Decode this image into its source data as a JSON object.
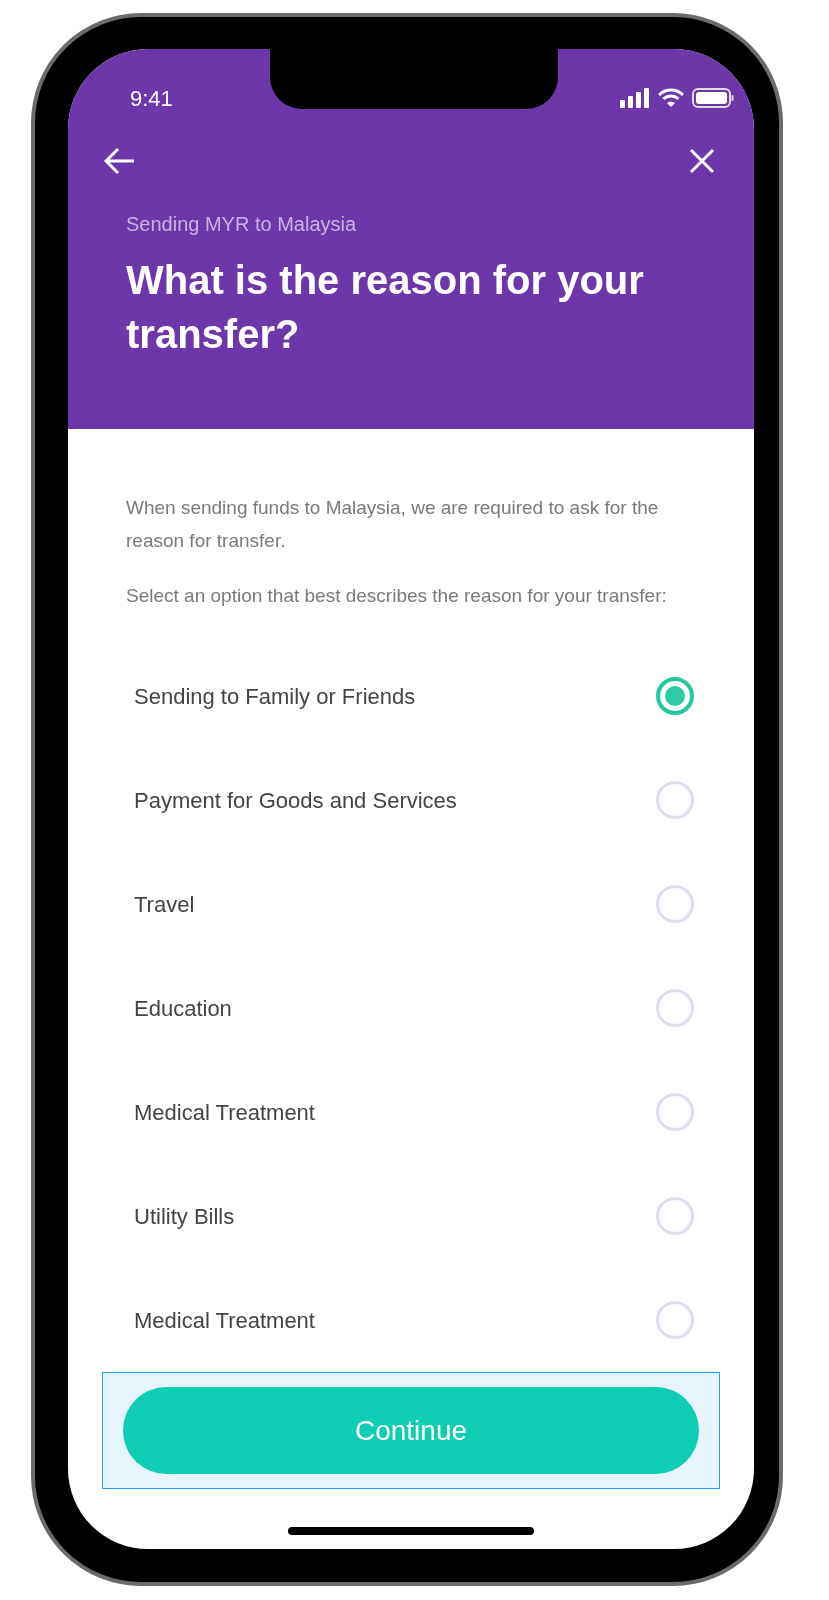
{
  "status_bar": {
    "time": "9:41"
  },
  "header": {
    "subtitle": "Sending MYR to Malaysia",
    "title": "What is the reason for your transfer?"
  },
  "intro": [
    "When sending funds to Malaysia, we are required to ask for the reason for transfer.",
    "Select an option that best describes the reason for your transfer:"
  ],
  "options": [
    {
      "label": "Sending to Family or Friends",
      "selected": true
    },
    {
      "label": "Payment for Goods and Services",
      "selected": false
    },
    {
      "label": "Travel",
      "selected": false
    },
    {
      "label": "Education",
      "selected": false
    },
    {
      "label": "Medical Treatment",
      "selected": false
    },
    {
      "label": "Utility Bills",
      "selected": false
    },
    {
      "label": "Medical Treatment",
      "selected": false
    }
  ],
  "continue_button": {
    "label": "Continue"
  }
}
